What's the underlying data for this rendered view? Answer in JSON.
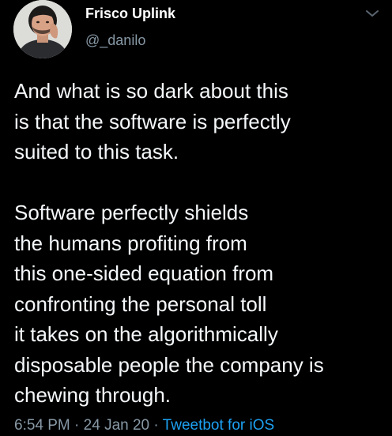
{
  "author": {
    "display_name": "Frisco Uplink",
    "handle": "@_danilo",
    "avatar_icon": "person-avatar"
  },
  "menu_icon": "chevron-down-icon",
  "tweet": {
    "paragraphs": [
      [
        "And what is so dark about this",
        "is that the software is perfectly",
        "suited to this task."
      ],
      [
        "Software perfectly shields",
        "the humans profiting from",
        "this one-sided equation from",
        "confronting the personal toll",
        "it takes on the algorithmically",
        "disposable people the company is",
        "chewing through."
      ]
    ]
  },
  "meta": {
    "time": "6:54 PM",
    "separator": " · ",
    "date": "24 Jan 20",
    "source": "Tweetbot for iOS"
  },
  "colors": {
    "background": "#000000",
    "text": "#f5f8fa",
    "secondary": "#8899a6",
    "link": "#1da1f2"
  }
}
